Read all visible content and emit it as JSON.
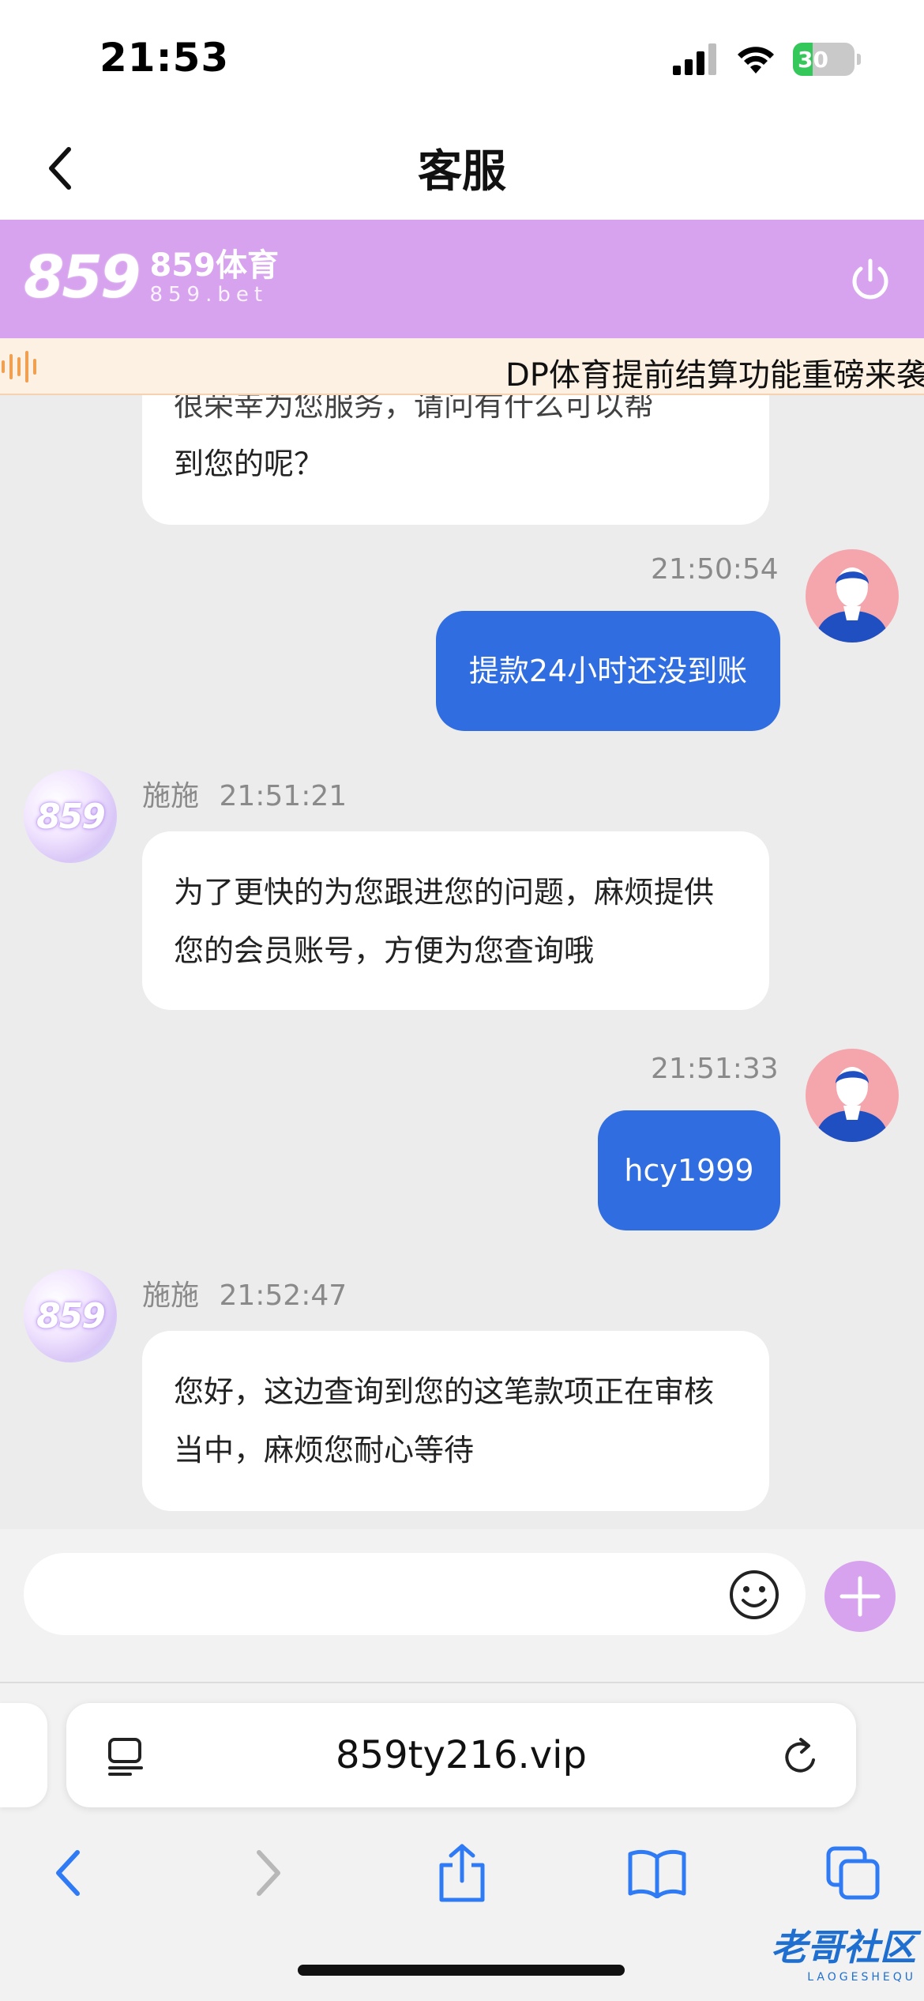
{
  "status_bar": {
    "time": "21:53",
    "battery": "30"
  },
  "header": {
    "title": "客服"
  },
  "brand": {
    "logo_number": "859",
    "name": "859体育",
    "url": "859.bet"
  },
  "marquee": {
    "text": "DP体育提前结算功能重磅来袭"
  },
  "messages": [
    {
      "side": "agent",
      "text_line1": "很荣幸为您服务，请问有什么可以帮",
      "text_line2": "到您的呢？"
    },
    {
      "side": "user",
      "time": "21:50:54",
      "text": "提款24小时还没到账"
    },
    {
      "side": "agent",
      "sender": "施施",
      "time": "21:51:21",
      "text": "为了更快的为您跟进您的问题，麻烦提供您的会员账号，方便为您查询哦"
    },
    {
      "side": "user",
      "time": "21:51:33",
      "text": "hcy1999"
    },
    {
      "side": "agent",
      "sender": "施施",
      "time": "21:52:47",
      "text": "您好，这边查询到您的这笔款项正在审核当中，麻烦您耐心等待"
    }
  ],
  "agent_avatar_text": "859",
  "input": {
    "placeholder": "",
    "value": ""
  },
  "browser": {
    "url": "859ty216.vip"
  },
  "watermark": {
    "text": "老哥社区",
    "sub": "LAOGESHEQU"
  },
  "colors": {
    "brand_purple": "#d7a3ee",
    "user_bubble": "#2f6de0",
    "chat_bg": "#ececec",
    "marquee_bg": "#fdf1e3"
  },
  "icons": [
    "back-icon",
    "power-icon",
    "signal-icon",
    "wifi-icon",
    "battery-icon",
    "sound-wave-icon",
    "user-avatar-icon",
    "agent-avatar-icon",
    "emoji-icon",
    "plus-icon",
    "reader-icon",
    "reload-icon",
    "nav-back-icon",
    "nav-forward-icon",
    "share-icon",
    "bookmarks-icon",
    "tabs-icon"
  ]
}
